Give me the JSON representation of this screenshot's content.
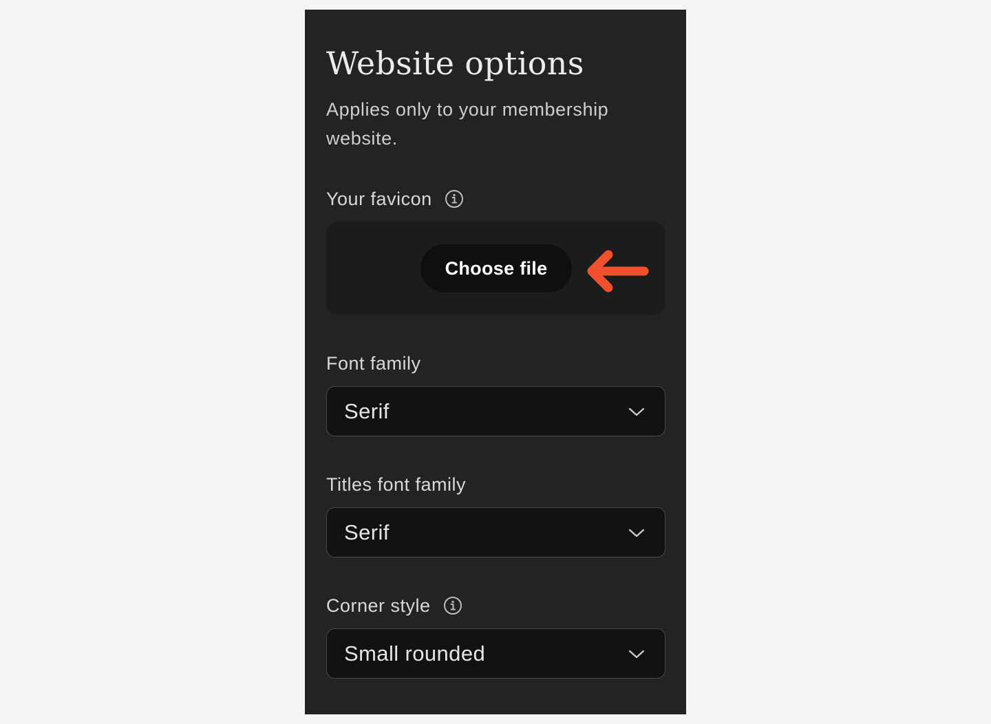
{
  "panel": {
    "title": "Website options",
    "subtitle": "Applies only to your membership website."
  },
  "favicon": {
    "label": "Your favicon",
    "info_icon": "info-circle-icon",
    "button_label": "Choose file",
    "arrow_icon": "arrow-left-icon",
    "arrow_color": "#f0502c"
  },
  "font_family": {
    "label": "Font family",
    "selected": "Serif",
    "chevron_icon": "chevron-down-icon"
  },
  "titles_font_family": {
    "label": "Titles font family",
    "selected": "Serif",
    "chevron_icon": "chevron-down-icon"
  },
  "corner_style": {
    "label": "Corner style",
    "info_icon": "info-circle-icon",
    "selected": "Small rounded",
    "chevron_icon": "chevron-down-icon"
  },
  "colors": {
    "page_background": "#f5f5f7",
    "panel_background": "#232323",
    "select_background": "#121212",
    "accent": "#f0502c"
  }
}
